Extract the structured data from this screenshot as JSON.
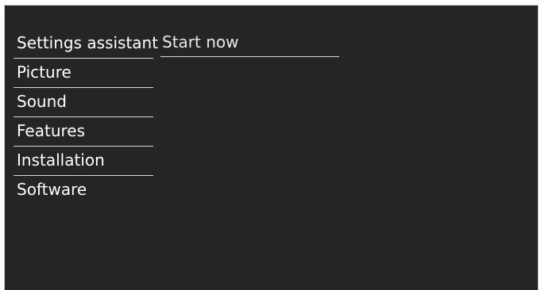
{
  "menu": {
    "items": [
      {
        "label": "Settings assistant"
      },
      {
        "label": "Picture"
      },
      {
        "label": "Sound"
      },
      {
        "label": "Features"
      },
      {
        "label": "Installation"
      },
      {
        "label": "Software"
      }
    ],
    "selected_index": 0
  },
  "submenu": {
    "items": [
      {
        "label": "Start now"
      }
    ]
  },
  "colors": {
    "background": "#262424",
    "frame": "#cfcfcf",
    "text": "#ffffff",
    "separator": "#d8d8d8"
  }
}
